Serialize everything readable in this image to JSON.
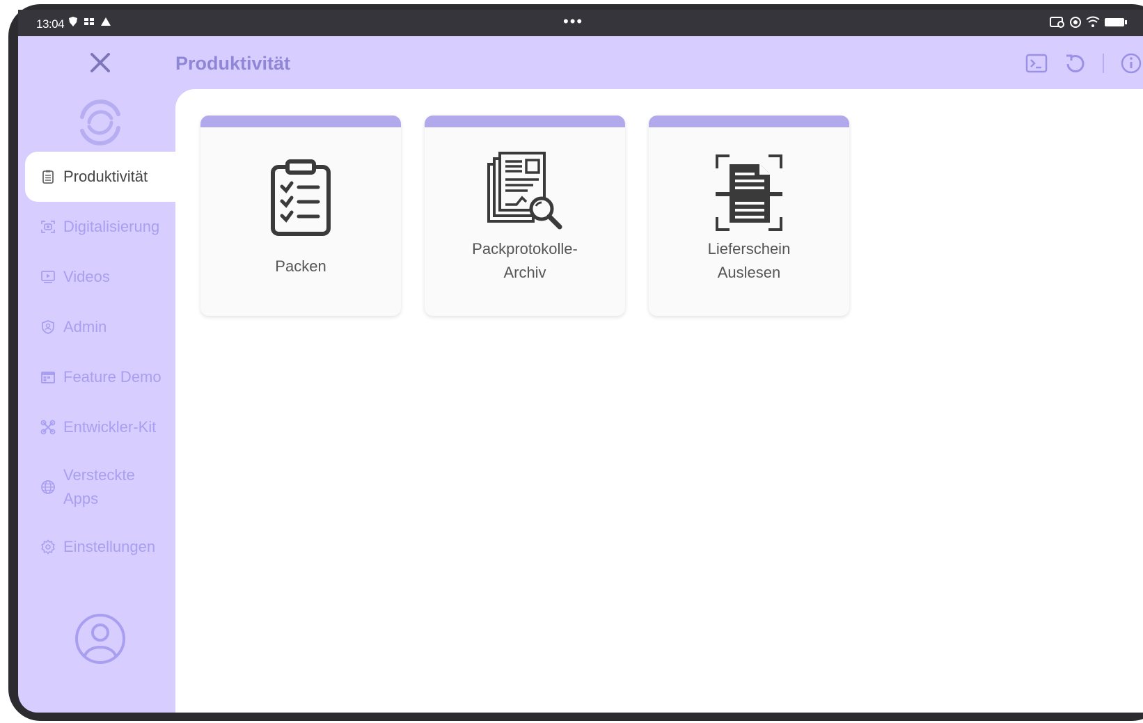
{
  "status": {
    "time": "13:04",
    "dots": "•••"
  },
  "header": {
    "title": "Produktivität"
  },
  "sidebar": {
    "items": [
      {
        "label": "Produktivität",
        "icon": "clipboard-icon",
        "active": true
      },
      {
        "label": "Digitalisierung",
        "icon": "scan-icon"
      },
      {
        "label": "Videos",
        "icon": "video-icon"
      },
      {
        "label": "Admin",
        "icon": "admin-shield-icon"
      },
      {
        "label": "Feature Demo",
        "icon": "calendar-icon"
      },
      {
        "label": "Entwickler-Kit",
        "icon": "tools-icon"
      },
      {
        "label": "Versteckte Apps",
        "line1": "Versteckte",
        "line2": "Apps",
        "icon": "globe-icon"
      },
      {
        "label": "Einstellungen",
        "icon": "gear-icon"
      }
    ]
  },
  "tiles": [
    {
      "label": "Packen",
      "icon": "checklist-clipboard-icon"
    },
    {
      "label": "Packprotokolle-Archiv",
      "line1": "Packprotokolle-",
      "line2": "Archiv",
      "icon": "document-search-icon"
    },
    {
      "label": "Lieferschein Auslesen",
      "line1": "Lieferschein",
      "line2": "Auslesen",
      "icon": "document-scan-icon"
    }
  ],
  "colors": {
    "accent": "#d7ceff",
    "accent_text": "#a99ff0",
    "tile_bar": "#b1a9ec",
    "device_frame": "#2c2c30"
  }
}
